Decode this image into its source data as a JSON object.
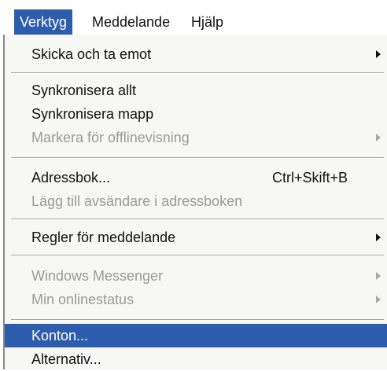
{
  "menubar": {
    "items": [
      {
        "label": "Verktyg"
      },
      {
        "label": "Meddelande"
      },
      {
        "label": "Hjälp"
      }
    ]
  },
  "menu": {
    "items": [
      {
        "label": "Skicka och ta emot",
        "submenu": true
      },
      {
        "label": "Synkronisera allt"
      },
      {
        "label": "Synkronisera mapp"
      },
      {
        "label": "Markera för offlinevisning",
        "disabled": true,
        "submenu": true
      },
      {
        "label": "Adressbok...",
        "shortcut": "Ctrl+Skift+B"
      },
      {
        "label": "Lägg till avsändare i adressboken",
        "disabled": true
      },
      {
        "label": "Regler för meddelande",
        "submenu": true
      },
      {
        "label": "Windows Messenger",
        "disabled": true,
        "submenu": true
      },
      {
        "label": "Min onlinestatus",
        "disabled": true,
        "submenu": true
      },
      {
        "label": "Konton...",
        "highlighted": true
      },
      {
        "label": "Alternativ..."
      }
    ]
  },
  "colors": {
    "highlight": "#2f5dad",
    "disabled_text": "#9a9a9a",
    "menu_background": "#f7f7f5"
  }
}
